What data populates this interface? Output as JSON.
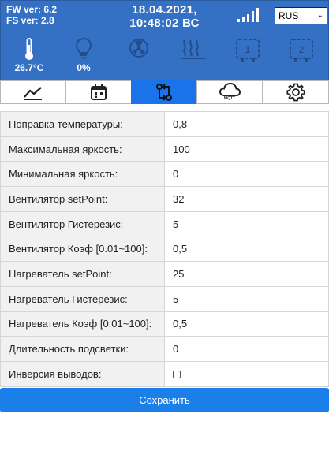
{
  "header": {
    "fw": "FW ver: 6.2",
    "fs": "FS ver: 2.8",
    "date": "18.04.2021,",
    "time": "10:48:02 ВС",
    "language": "RUS"
  },
  "sensors": {
    "temperature": "26.7°C",
    "light": "0%",
    "relay1": "1",
    "relay2": "2"
  },
  "tabs": {
    "mqtt_label": "MQTT"
  },
  "settings": [
    {
      "label": "Поправка температуры:",
      "value": "0,8"
    },
    {
      "label": "Максимальная яркость:",
      "value": "100"
    },
    {
      "label": "Минимальная яркость:",
      "value": "0"
    },
    {
      "label": "Вентилятор setPoint:",
      "value": "32"
    },
    {
      "label": "Вентилятор Гистерезис:",
      "value": "5"
    },
    {
      "label": "Вентилятор Коэф [0.01~100]:",
      "value": "0,5"
    },
    {
      "label": "Нагреватель setPoint:",
      "value": "25"
    },
    {
      "label": "Нагреватель Гистерезис:",
      "value": "5"
    },
    {
      "label": "Нагреватель Коэф [0.01~100]:",
      "value": "0,5"
    },
    {
      "label": "Длительность подсветки:",
      "value": "0"
    },
    {
      "label": "Инверсия выводов:",
      "value": ""
    }
  ],
  "save_label": "Сохранить",
  "colors": {
    "header_bg": "#3471c4",
    "accent": "#1a73e8",
    "label_bg": "#f1f1f1"
  }
}
